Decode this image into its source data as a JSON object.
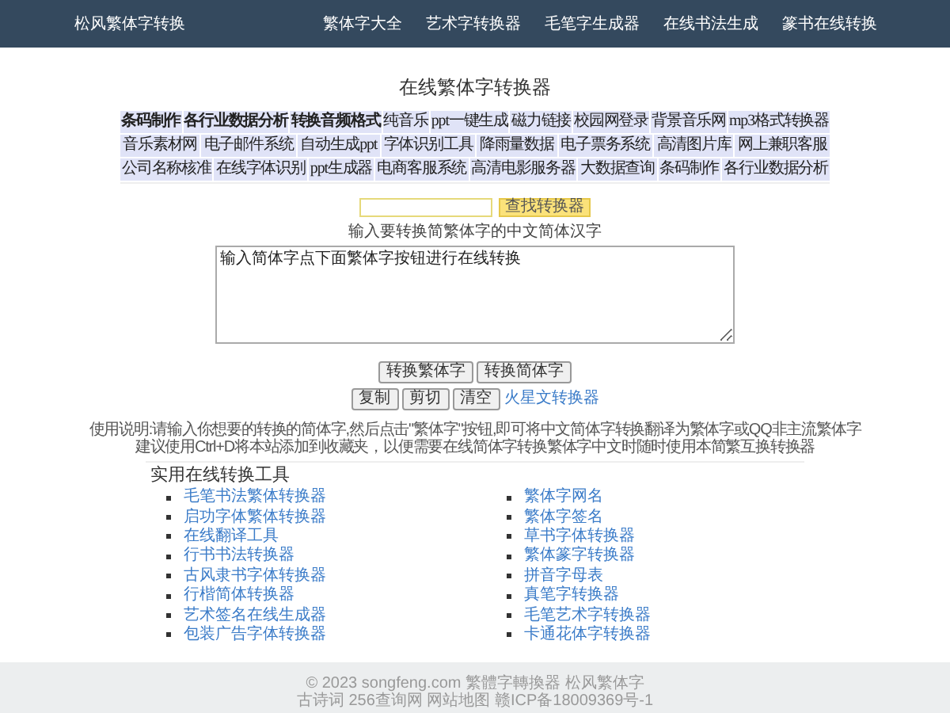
{
  "header": {
    "logo": "松风繁体字转换",
    "nav": [
      "繁体字大全",
      "艺术字转换器",
      "毛笔字生成器",
      "在线书法生成",
      "篆书在线转换"
    ]
  },
  "title": "在线繁体字转换器",
  "link_table": [
    [
      {
        "label": "条码制作",
        "bold": true
      },
      {
        "label": "各行业数据分析",
        "bold": true
      },
      {
        "label": "转换音频格式",
        "bold": true
      },
      {
        "label": "纯音乐",
        "bold": false
      },
      {
        "label": "ppt一键生成",
        "bold": false
      },
      {
        "label": "磁力链接",
        "bold": false
      },
      {
        "label": "校园网登录",
        "bold": false
      },
      {
        "label": "背景音乐网",
        "bold": false
      },
      {
        "label": "mp3格式转换器",
        "bold": false
      }
    ],
    [
      {
        "label": "音乐素材网",
        "bold": false
      },
      {
        "label": "电子邮件系统",
        "bold": false
      },
      {
        "label": "自动生成ppt",
        "bold": false
      },
      {
        "label": "字体识别工具",
        "bold": false
      },
      {
        "label": "降雨量数据",
        "bold": false
      },
      {
        "label": "电子票务系统",
        "bold": false
      },
      {
        "label": "高清图片库",
        "bold": false
      },
      {
        "label": "网上兼职客服",
        "bold": false
      }
    ],
    [
      {
        "label": "公司名称核准",
        "bold": false
      },
      {
        "label": "在线字体识别",
        "bold": false
      },
      {
        "label": "ppt生成器",
        "bold": false
      },
      {
        "label": "电商客服系统",
        "bold": false
      },
      {
        "label": "高清电影服务器",
        "bold": false
      },
      {
        "label": "大数据查询",
        "bold": false
      },
      {
        "label": "条码制作",
        "bold": false
      },
      {
        "label": "各行业数据分析",
        "bold": false
      }
    ]
  ],
  "search": {
    "button": "查找转换器"
  },
  "input_label": "输入要转换简繁体字的中文简体汉字",
  "textarea": {
    "value": "输入简体字点下面繁体字按钮进行在线转换"
  },
  "convert_buttons": [
    "转换繁体字",
    "转换简体字"
  ],
  "edit_buttons": [
    "复制",
    "剪切",
    "清空"
  ],
  "edit_link": "火星文转换器",
  "usage": [
    "使用说明:请输入你想要的转换的简体字,然后点击\"繁体字\"按钮,即可将中文简体字转换翻译为繁体字或QQ非主流繁体字",
    "建议使用Ctrl+D将本站添加到收藏夹，以便需要在线简体字转换繁体字中文时随时使用本简繁互换转换器"
  ],
  "tools": {
    "heading": "实用在线转换工具",
    "left": [
      "毛笔书法繁体转换器",
      "启功字体繁体转换器",
      "在线翻译工具",
      "行书书法转换器",
      "古风隶书字体转换器",
      "行楷简体转换器",
      "艺术签名在线生成器",
      "包装广告字体转换器"
    ],
    "right": [
      "繁体字网名",
      "繁体字签名",
      "草书字体转换器",
      "繁体篆字转换器",
      "拼音字母表",
      "真笔字转换器",
      "毛笔艺术字转换器",
      "卡通花体字转换器"
    ]
  },
  "footer": [
    "© 2023 songfeng.com 繁體字轉換器 松风繁体字",
    "古诗词 256查询网 网站地图 赣ICP备18009369号-1"
  ]
}
